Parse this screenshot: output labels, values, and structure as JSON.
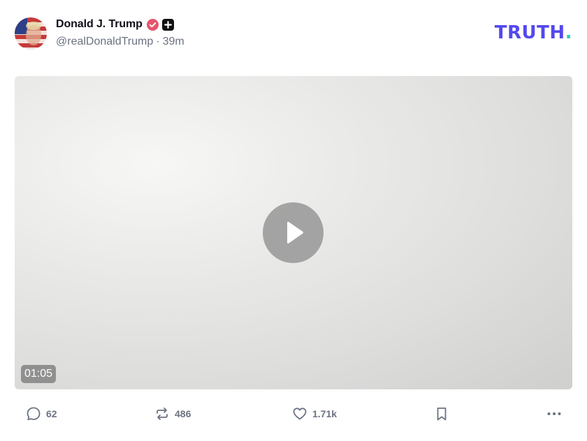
{
  "post": {
    "author": {
      "display_name": "Donald J. Trump",
      "handle": "@realDonaldTrump",
      "separator": "·",
      "time_ago": "39m"
    },
    "brand": {
      "text": "TRUTH",
      "dot": "."
    },
    "video": {
      "duration": "01:05"
    },
    "actions": {
      "replies": "62",
      "retruths": "486",
      "likes": "1.71k"
    }
  },
  "colors": {
    "brand_purple": "#5448ee",
    "brand_teal": "#30c9c0",
    "verified_badge": "#e5566f",
    "muted_text": "#6b7280"
  },
  "icons": {
    "verified": "verified-badge-icon",
    "plus": "plus-badge-icon",
    "play": "play-icon",
    "reply": "reply-icon",
    "retruth": "retruth-icon",
    "like": "heart-icon",
    "bookmark": "bookmark-icon",
    "more": "more-icon"
  }
}
